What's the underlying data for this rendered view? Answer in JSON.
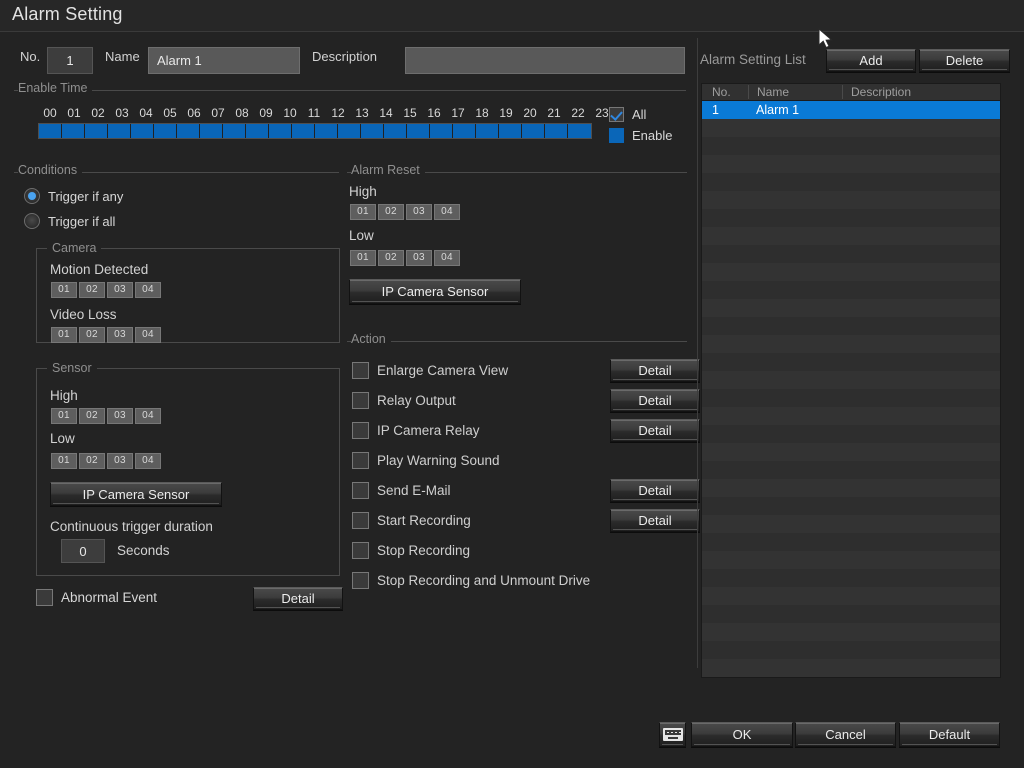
{
  "window": {
    "title": "Alarm Setting"
  },
  "header": {
    "no_label": "No.",
    "no_value": "1",
    "name_label": "Name",
    "name_value": "Alarm 1",
    "description_label": "Description",
    "description_value": ""
  },
  "enable_time": {
    "legend": "Enable Time",
    "hours": [
      "00",
      "01",
      "02",
      "03",
      "04",
      "05",
      "06",
      "07",
      "08",
      "09",
      "10",
      "11",
      "12",
      "13",
      "14",
      "15",
      "16",
      "17",
      "18",
      "19",
      "20",
      "21",
      "22",
      "23"
    ],
    "enabled_hours": [
      true,
      true,
      true,
      true,
      true,
      true,
      true,
      true,
      true,
      true,
      true,
      true,
      true,
      true,
      true,
      true,
      true,
      true,
      true,
      true,
      true,
      true,
      true,
      true
    ],
    "all_label": "All",
    "all_checked": true,
    "enable_label": "Enable",
    "enable_color": "#0a66b8"
  },
  "conditions": {
    "legend": "Conditions",
    "radios": [
      {
        "label": "Trigger if any",
        "selected": true
      },
      {
        "label": "Trigger if all",
        "selected": false
      }
    ],
    "camera": {
      "legend": "Camera",
      "motion_label": "Motion Detected",
      "motion_chips": [
        "01",
        "02",
        "03",
        "04"
      ],
      "video_loss_label": "Video Loss",
      "video_loss_chips": [
        "01",
        "02",
        "03",
        "04"
      ]
    },
    "sensor": {
      "legend": "Sensor",
      "high_label": "High",
      "high_chips": [
        "01",
        "02",
        "03",
        "04"
      ],
      "low_label": "Low",
      "low_chips": [
        "01",
        "02",
        "03",
        "04"
      ],
      "ip_camera_sensor_label": "IP Camera Sensor",
      "duration_label": "Continuous trigger duration",
      "duration_value": "0",
      "seconds_label": "Seconds"
    },
    "abnormal_event_label": "Abnormal Event",
    "abnormal_event_checked": false,
    "abnormal_event_detail_label": "Detail"
  },
  "alarm_reset": {
    "legend": "Alarm Reset",
    "high_label": "High",
    "high_chips": [
      "01",
      "02",
      "03",
      "04"
    ],
    "low_label": "Low",
    "low_chips": [
      "01",
      "02",
      "03",
      "04"
    ],
    "ip_camera_sensor_label": "IP Camera Sensor"
  },
  "action": {
    "legend": "Action",
    "items": [
      {
        "label": "Enlarge Camera View",
        "checked": false,
        "detail": "Detail"
      },
      {
        "label": "Relay Output",
        "checked": false,
        "detail": "Detail"
      },
      {
        "label": "IP Camera Relay",
        "checked": false,
        "detail": "Detail"
      },
      {
        "label": "Play Warning Sound",
        "checked": false,
        "detail": ""
      },
      {
        "label": "Send E-Mail",
        "checked": false,
        "detail": "Detail"
      },
      {
        "label": "Start Recording",
        "checked": false,
        "detail": "Detail"
      },
      {
        "label": "Stop Recording",
        "checked": false,
        "detail": ""
      },
      {
        "label": "Stop Recording and Unmount Drive",
        "checked": false,
        "detail": ""
      }
    ]
  },
  "alarm_list": {
    "title": "Alarm Setting List",
    "add_label": "Add",
    "delete_label": "Delete",
    "columns": [
      "No.",
      "Name",
      "Description"
    ],
    "rows": [
      {
        "no": "1",
        "name": "Alarm 1",
        "description": "",
        "selected": true
      }
    ],
    "empty_row_count": 31,
    "selection_color": "#0a7ad6"
  },
  "footer": {
    "keyboard_icon": "keyboard-icon",
    "ok_label": "OK",
    "cancel_label": "Cancel",
    "default_label": "Default"
  }
}
